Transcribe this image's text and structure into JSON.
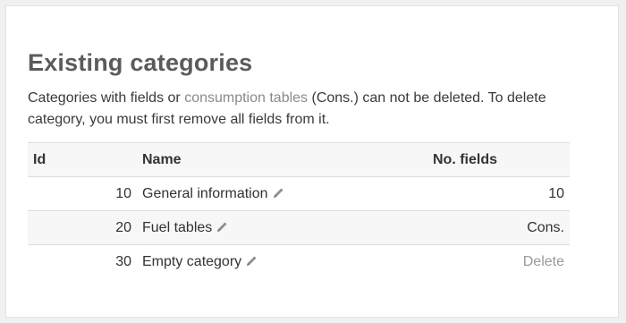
{
  "section": {
    "title": "Existing categories",
    "desc_before": "Categories with fields or ",
    "desc_link": "consumption tables",
    "desc_after": " (Cons.) can not be deleted. To delete category, you must first remove all fields from it."
  },
  "table": {
    "headers": {
      "id": "Id",
      "name": "Name",
      "fields": "No. fields"
    },
    "rows": [
      {
        "id": "10",
        "name": "General information",
        "fields": "10",
        "edit_icon": "pencil-icon"
      },
      {
        "id": "20",
        "name": "Fuel tables",
        "fields": "Cons.",
        "edit_icon": "pencil-icon"
      },
      {
        "id": "30",
        "name": "Empty category",
        "fields": "Delete",
        "edit_icon": "pencil-icon"
      }
    ]
  }
}
